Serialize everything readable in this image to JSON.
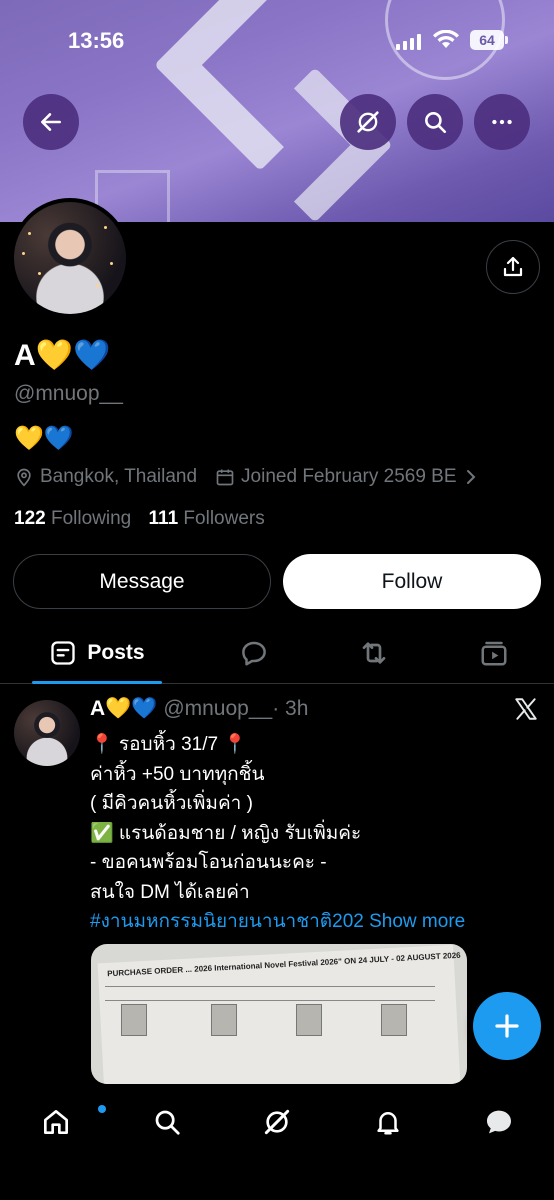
{
  "status_bar": {
    "time": "13:56",
    "battery": "64"
  },
  "profile": {
    "name": "A💛💙",
    "handle": "@mnuop__",
    "bio": "💛💙",
    "location": "Bangkok, Thailand",
    "joined": "Joined February 2569 BE",
    "following_count": "122",
    "following_label": "Following",
    "followers_count": "111",
    "followers_label": "Followers"
  },
  "actions": {
    "message_label": "Message",
    "follow_label": "Follow"
  },
  "tabs": {
    "posts_label": "Posts"
  },
  "post": {
    "name": "A💛💙",
    "handle": "@mnuop__",
    "time": "· 3h",
    "lines": [
      "📍 รอบหิ้ว 31/7 📍",
      "ค่าหิ้ว +50 บาททุกชิ้น",
      "( มีคิวคนหิ้วเพิ่มค่า )",
      "✅ แรนด้อมชาย / หญิง รับเพิ่มค่ะ",
      "- ขอคนพร้อมโอนก่อนนะคะ -",
      "สนใจ DM ได้เลยค่า"
    ],
    "hashtag": "#งานมหกรรมนิยายนานาชาติ202",
    "show_more": "Show more",
    "image_header": "PURCHASE ORDER ... 2026 International Novel Festival 2026\" ON 24 JULY - 02 AUGUST 2026"
  },
  "colors": {
    "accent": "#1d9bf0",
    "banner": "#8a74c6",
    "background": "#000000"
  }
}
